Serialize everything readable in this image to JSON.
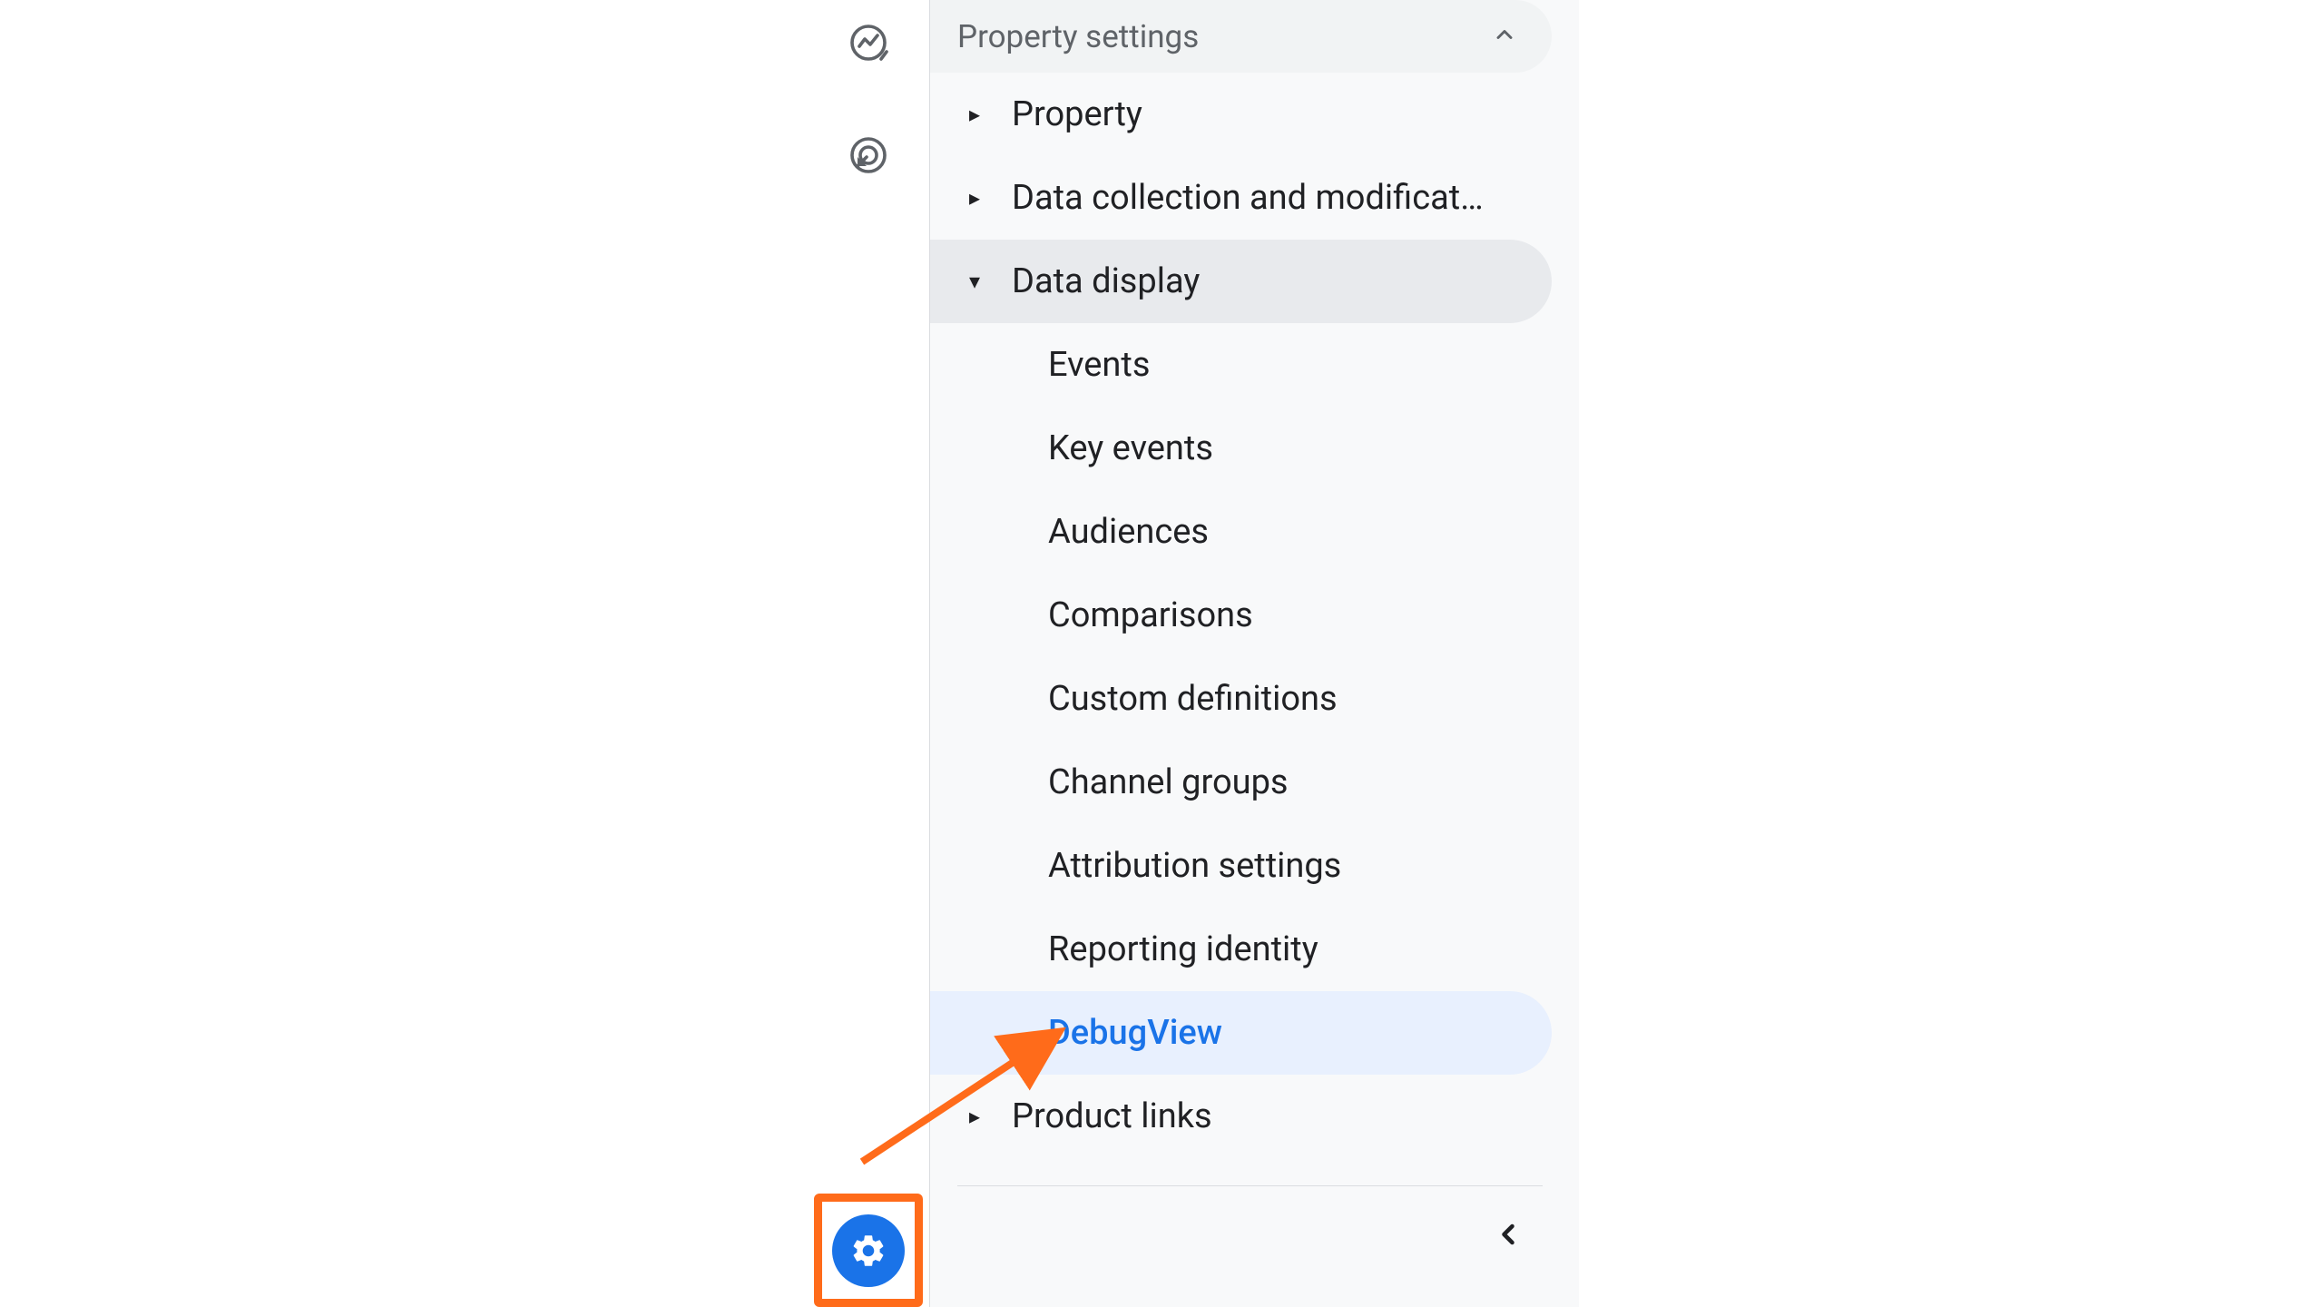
{
  "section_header": "Property settings",
  "nav": {
    "property": "Property",
    "data_collection": "Data collection and modification",
    "data_display": "Data display",
    "product_links": "Product links"
  },
  "sub_items": {
    "events": "Events",
    "key_events": "Key events",
    "audiences": "Audiences",
    "comparisons": "Comparisons",
    "custom_definitions": "Custom definitions",
    "channel_groups": "Channel groups",
    "attribution_settings": "Attribution settings",
    "reporting_identity": "Reporting identity",
    "debug_view": "DebugView"
  },
  "colors": {
    "accent": "#1a73e8",
    "highlight": "#ff6b1a",
    "active_bg": "#e8f0fe",
    "expanded_bg": "#e8eaed",
    "header_bg": "#f1f3f4",
    "text": "#202124",
    "muted": "#5f6368"
  }
}
